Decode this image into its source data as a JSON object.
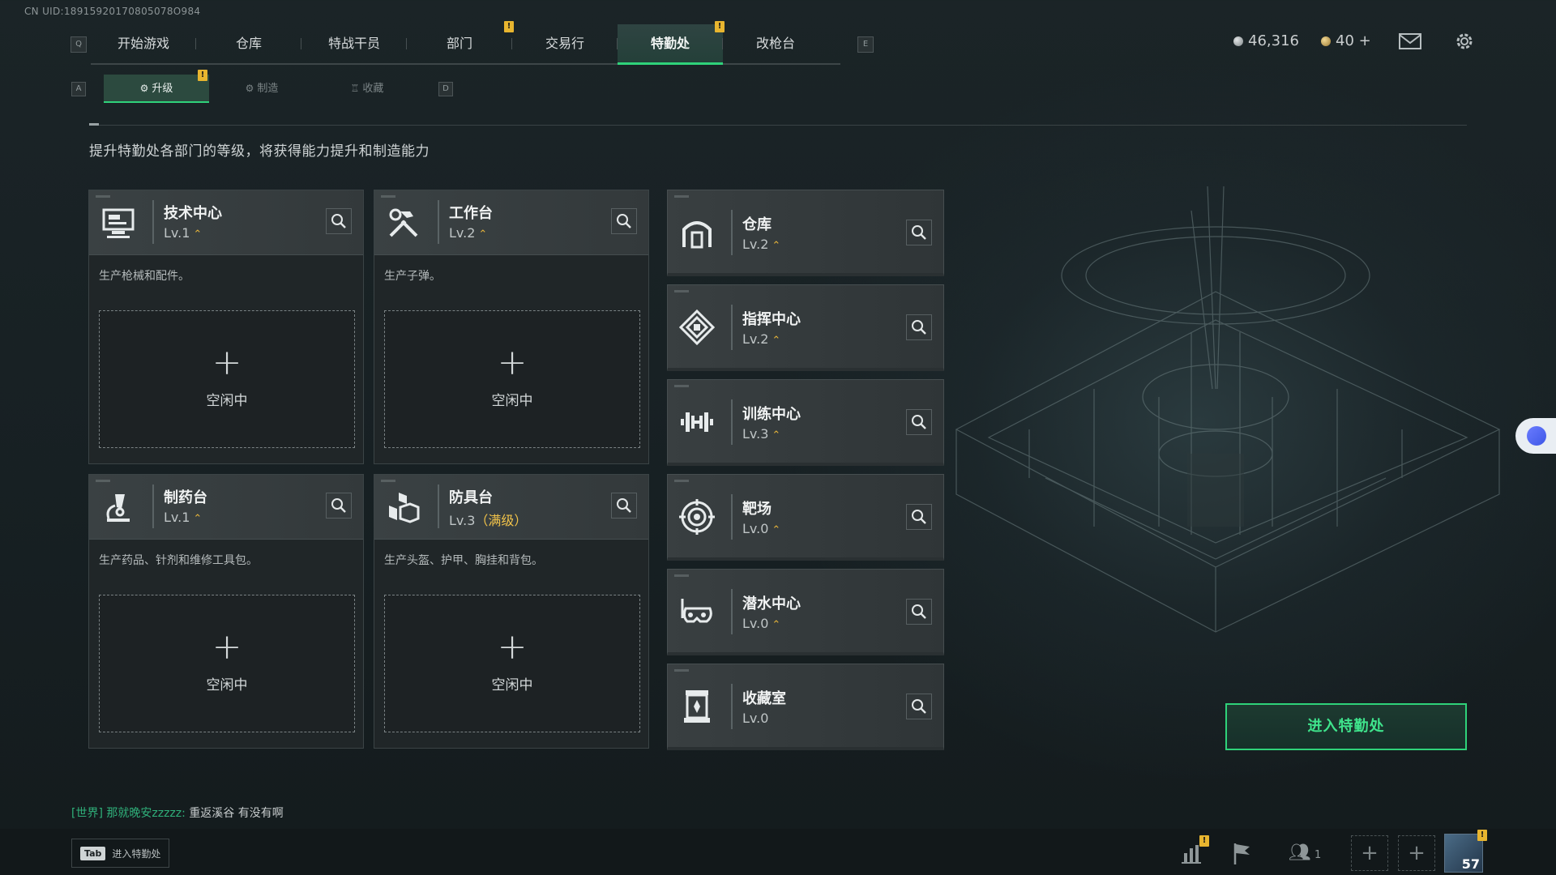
{
  "uid": "CN UID:18915920170805078O984",
  "topnav": {
    "key_left": "Q",
    "key_right": "E",
    "tabs": [
      {
        "label": "开始游戏"
      },
      {
        "label": "仓库"
      },
      {
        "label": "特战干员"
      },
      {
        "label": "部门"
      },
      {
        "label": "交易行"
      },
      {
        "label": "特勤处"
      },
      {
        "label": "改枪台"
      }
    ],
    "active_tab": "特勤处",
    "badge_text": "!"
  },
  "currency": {
    "silver": "46,316",
    "gold": "40 +"
  },
  "subnav": {
    "key_left": "A",
    "key_right": "D",
    "tabs": [
      {
        "label": "升级"
      },
      {
        "label": "制造"
      },
      {
        "label": "收藏"
      }
    ],
    "active_tab": "升级"
  },
  "subtitle": "提升特勤处各部门的等级，将获得能力提升和制造能力",
  "cards": [
    {
      "name": "技术中心",
      "level": "Lv.1",
      "desc": "生产枪械和配件。",
      "slot_status": "空闲中",
      "icon": "computer-icon"
    },
    {
      "name": "工作台",
      "level": "Lv.2",
      "desc": "生产子弹。",
      "slot_status": "空闲中",
      "icon": "tools-icon"
    },
    {
      "name": "制药台",
      "level": "Lv.1",
      "desc": "生产药品、针剂和维修工具包。",
      "slot_status": "空闲中",
      "icon": "microscope-icon"
    },
    {
      "name": "防具台",
      "level": "Lv.3",
      "level_suffix": "（满级）",
      "desc": "生产头盔、护甲、胸挂和背包。",
      "slot_status": "空闲中",
      "icon": "armor-icon"
    }
  ],
  "facilities": [
    {
      "name": "仓库",
      "level": "Lv.2",
      "icon": "warehouse-icon"
    },
    {
      "name": "指挥中心",
      "level": "Lv.2",
      "icon": "command-icon"
    },
    {
      "name": "训练中心",
      "level": "Lv.3",
      "icon": "dumbbell-icon"
    },
    {
      "name": "靶场",
      "level": "Lv.0",
      "icon": "target-icon"
    },
    {
      "name": "潜水中心",
      "level": "Lv.0",
      "icon": "diving-mask-icon"
    },
    {
      "name": "收藏室",
      "level": "Lv.0",
      "icon": "collection-icon"
    }
  ],
  "enter_button": "进入特勤处",
  "chat": {
    "channel": "[世界]",
    "sender": "那就晚安zzzzz:",
    "message": "重返溪谷  有没有啊"
  },
  "tab_hint": {
    "key": "Tab",
    "label": "进入特勤处"
  },
  "bottom": {
    "friends_count": "1",
    "player_level": "57"
  },
  "colors": {
    "accent": "#2fd27a",
    "badge": "#e8b52f",
    "panel": "#3a4143"
  }
}
